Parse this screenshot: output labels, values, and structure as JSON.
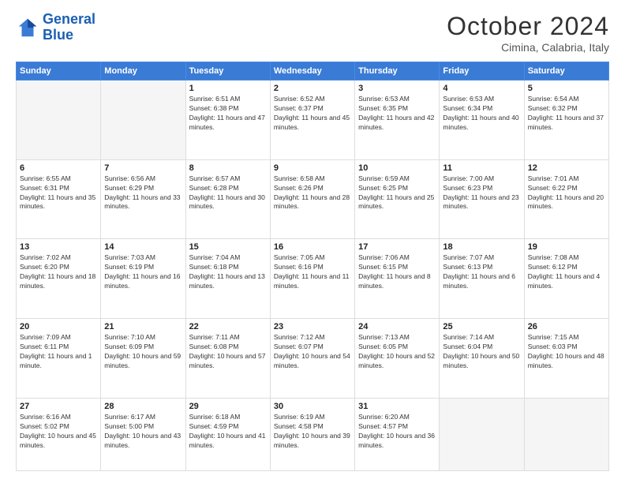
{
  "header": {
    "logo_line1": "General",
    "logo_line2": "Blue",
    "month": "October 2024",
    "location": "Cimina, Calabria, Italy"
  },
  "weekdays": [
    "Sunday",
    "Monday",
    "Tuesday",
    "Wednesday",
    "Thursday",
    "Friday",
    "Saturday"
  ],
  "weeks": [
    [
      {
        "day": "",
        "empty": true
      },
      {
        "day": "",
        "empty": true
      },
      {
        "day": "1",
        "sunrise": "6:51 AM",
        "sunset": "6:38 PM",
        "daylight": "11 hours and 47 minutes."
      },
      {
        "day": "2",
        "sunrise": "6:52 AM",
        "sunset": "6:37 PM",
        "daylight": "11 hours and 45 minutes."
      },
      {
        "day": "3",
        "sunrise": "6:53 AM",
        "sunset": "6:35 PM",
        "daylight": "11 hours and 42 minutes."
      },
      {
        "day": "4",
        "sunrise": "6:53 AM",
        "sunset": "6:34 PM",
        "daylight": "11 hours and 40 minutes."
      },
      {
        "day": "5",
        "sunrise": "6:54 AM",
        "sunset": "6:32 PM",
        "daylight": "11 hours and 37 minutes."
      }
    ],
    [
      {
        "day": "6",
        "sunrise": "6:55 AM",
        "sunset": "6:31 PM",
        "daylight": "11 hours and 35 minutes."
      },
      {
        "day": "7",
        "sunrise": "6:56 AM",
        "sunset": "6:29 PM",
        "daylight": "11 hours and 33 minutes."
      },
      {
        "day": "8",
        "sunrise": "6:57 AM",
        "sunset": "6:28 PM",
        "daylight": "11 hours and 30 minutes."
      },
      {
        "day": "9",
        "sunrise": "6:58 AM",
        "sunset": "6:26 PM",
        "daylight": "11 hours and 28 minutes."
      },
      {
        "day": "10",
        "sunrise": "6:59 AM",
        "sunset": "6:25 PM",
        "daylight": "11 hours and 25 minutes."
      },
      {
        "day": "11",
        "sunrise": "7:00 AM",
        "sunset": "6:23 PM",
        "daylight": "11 hours and 23 minutes."
      },
      {
        "day": "12",
        "sunrise": "7:01 AM",
        "sunset": "6:22 PM",
        "daylight": "11 hours and 20 minutes."
      }
    ],
    [
      {
        "day": "13",
        "sunrise": "7:02 AM",
        "sunset": "6:20 PM",
        "daylight": "11 hours and 18 minutes."
      },
      {
        "day": "14",
        "sunrise": "7:03 AM",
        "sunset": "6:19 PM",
        "daylight": "11 hours and 16 minutes."
      },
      {
        "day": "15",
        "sunrise": "7:04 AM",
        "sunset": "6:18 PM",
        "daylight": "11 hours and 13 minutes."
      },
      {
        "day": "16",
        "sunrise": "7:05 AM",
        "sunset": "6:16 PM",
        "daylight": "11 hours and 11 minutes."
      },
      {
        "day": "17",
        "sunrise": "7:06 AM",
        "sunset": "6:15 PM",
        "daylight": "11 hours and 8 minutes."
      },
      {
        "day": "18",
        "sunrise": "7:07 AM",
        "sunset": "6:13 PM",
        "daylight": "11 hours and 6 minutes."
      },
      {
        "day": "19",
        "sunrise": "7:08 AM",
        "sunset": "6:12 PM",
        "daylight": "11 hours and 4 minutes."
      }
    ],
    [
      {
        "day": "20",
        "sunrise": "7:09 AM",
        "sunset": "6:11 PM",
        "daylight": "11 hours and 1 minute."
      },
      {
        "day": "21",
        "sunrise": "7:10 AM",
        "sunset": "6:09 PM",
        "daylight": "10 hours and 59 minutes."
      },
      {
        "day": "22",
        "sunrise": "7:11 AM",
        "sunset": "6:08 PM",
        "daylight": "10 hours and 57 minutes."
      },
      {
        "day": "23",
        "sunrise": "7:12 AM",
        "sunset": "6:07 PM",
        "daylight": "10 hours and 54 minutes."
      },
      {
        "day": "24",
        "sunrise": "7:13 AM",
        "sunset": "6:05 PM",
        "daylight": "10 hours and 52 minutes."
      },
      {
        "day": "25",
        "sunrise": "7:14 AM",
        "sunset": "6:04 PM",
        "daylight": "10 hours and 50 minutes."
      },
      {
        "day": "26",
        "sunrise": "7:15 AM",
        "sunset": "6:03 PM",
        "daylight": "10 hours and 48 minutes."
      }
    ],
    [
      {
        "day": "27",
        "sunrise": "6:16 AM",
        "sunset": "5:02 PM",
        "daylight": "10 hours and 45 minutes."
      },
      {
        "day": "28",
        "sunrise": "6:17 AM",
        "sunset": "5:00 PM",
        "daylight": "10 hours and 43 minutes."
      },
      {
        "day": "29",
        "sunrise": "6:18 AM",
        "sunset": "4:59 PM",
        "daylight": "10 hours and 41 minutes."
      },
      {
        "day": "30",
        "sunrise": "6:19 AM",
        "sunset": "4:58 PM",
        "daylight": "10 hours and 39 minutes."
      },
      {
        "day": "31",
        "sunrise": "6:20 AM",
        "sunset": "4:57 PM",
        "daylight": "10 hours and 36 minutes."
      },
      {
        "day": "",
        "empty": true
      },
      {
        "day": "",
        "empty": true
      }
    ]
  ]
}
